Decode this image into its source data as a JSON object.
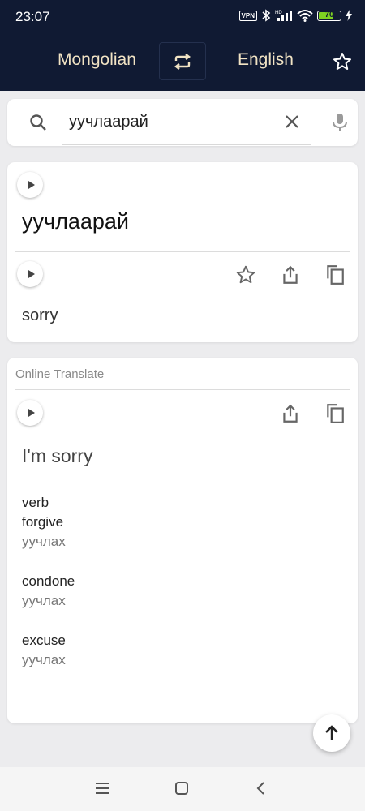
{
  "status_bar": {
    "time": "23:07",
    "vpn": "VPN",
    "battery": "70",
    "battery_level": 0.7
  },
  "header": {
    "source_language": "Mongolian",
    "target_language": "English"
  },
  "search": {
    "query": "уучлаарай"
  },
  "dictionary_card": {
    "source_word": "уучлаарай",
    "translation": "sorry"
  },
  "online_card": {
    "label": "Online Translate",
    "main_translation": "I'm sorry",
    "pos": "verb",
    "entries": [
      {
        "term": "forgive",
        "synonym": "уучлах"
      },
      {
        "term": "condone",
        "synonym": "уучлах"
      },
      {
        "term": "excuse",
        "synonym": "уучлах"
      }
    ]
  },
  "colors": {
    "header_bg": "#101a33",
    "language_text": "#f1e3c4",
    "battery_fill": "#7ed321"
  }
}
